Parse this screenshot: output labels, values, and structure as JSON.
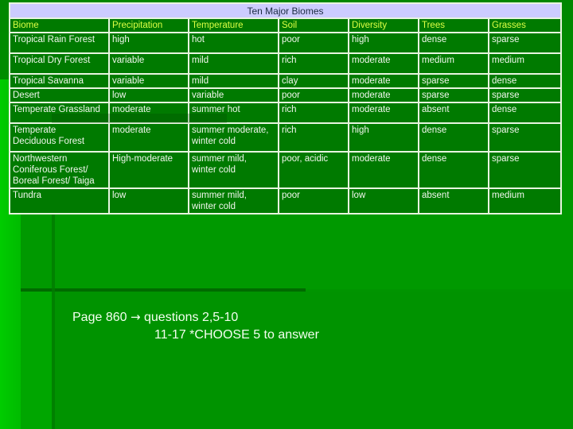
{
  "table": {
    "title": "Ten Major Biomes",
    "columns": [
      "Biome",
      "Precipitation",
      "Temperature",
      "Soil",
      "Diversity",
      "Trees",
      "Grasses"
    ],
    "rows": [
      [
        "Tropical Rain Forest",
        "high",
        "hot",
        "poor",
        "high",
        "dense",
        "sparse"
      ],
      [
        "Tropical Dry Forest",
        "variable",
        "mild",
        "rich",
        "moderate",
        "medium",
        "medium"
      ],
      [
        "Tropical Savanna",
        "variable",
        "mild",
        "clay",
        "moderate",
        "sparse",
        "dense"
      ],
      [
        "Desert",
        "low",
        "variable",
        "poor",
        "moderate",
        "sparse",
        "sparse"
      ],
      [
        "Temperate Grassland",
        "moderate",
        "summer hot",
        "rich",
        "moderate",
        "absent",
        "dense"
      ],
      [
        [
          "Temperate",
          "Deciduous Forest"
        ],
        "moderate",
        [
          "summer moderate,",
          "winter cold"
        ],
        "rich",
        "high",
        "dense",
        "sparse"
      ],
      [
        [
          "Northwestern",
          "Coniferous Forest/",
          "Boreal Forest/ Taiga"
        ],
        "High-moderate",
        [
          "summer mild,",
          "winter cold"
        ],
        "poor, acidic",
        "moderate",
        "dense",
        "sparse"
      ],
      [
        "Tundra",
        "low",
        [
          "summer mild,",
          "winter cold"
        ],
        "poor",
        "low",
        "absent",
        "medium"
      ]
    ]
  },
  "note": {
    "line1_prefix": "Page 860",
    "arrow_icon": "→",
    "line1_suffix": "questions 2,5-10",
    "line2": "11-17 *CHOOSE 5 to answer"
  },
  "colors": {
    "title_bg": "#CCCCFF",
    "header_text": "#DDFF44",
    "cell_bg": "#007A00",
    "background": "#009400"
  }
}
